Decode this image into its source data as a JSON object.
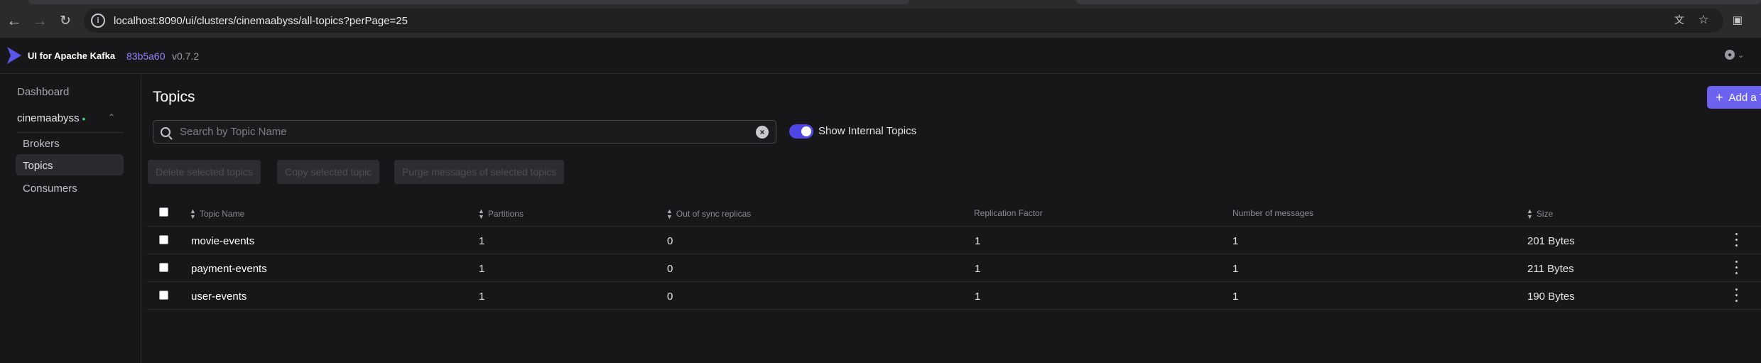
{
  "browser": {
    "url": "localhost:8090/ui/clusters/cinemaabyss/all-topics?perPage=25",
    "back_icon": "arrow-left-icon",
    "forward_icon": "arrow-right-icon",
    "reload_icon": "reload-icon",
    "info_icon": "info-icon",
    "translate_icon": "translate-icon",
    "bookmark_icon": "star-icon",
    "extensions_icon": "extensions-icon"
  },
  "header": {
    "brand": "UI for Apache Kafka",
    "version_hash": "83b5a60",
    "version": "v0.7.2",
    "logo_color": "#5b54e8"
  },
  "sidebar": {
    "dashboard": "Dashboard",
    "cluster": "cinemaabyss",
    "cluster_status_color": "#3fcf8e",
    "items": [
      {
        "label": "Brokers",
        "active": false
      },
      {
        "label": "Topics",
        "active": true
      },
      {
        "label": "Consumers",
        "active": false
      }
    ]
  },
  "main": {
    "title": "Topics",
    "add_button": "Add a Topic",
    "search": {
      "placeholder": "Search by Topic Name",
      "value": ""
    },
    "show_internal": {
      "label": "Show Internal Topics",
      "checked": true
    },
    "bulk_actions": [
      "Delete selected topics",
      "Copy selected topic",
      "Purge messages of selected topics"
    ],
    "columns": [
      {
        "label": "Topic Name",
        "sortable": true
      },
      {
        "label": "Partitions",
        "sortable": true
      },
      {
        "label": "Out of sync replicas",
        "sortable": true
      },
      {
        "label": "Replication Factor",
        "sortable": false
      },
      {
        "label": "Number of messages",
        "sortable": false
      },
      {
        "label": "Size",
        "sortable": true
      }
    ],
    "rows": [
      {
        "name": "movie-events",
        "partitions": "1",
        "out_of_sync": "0",
        "replication": "1",
        "messages": "1",
        "size": "201 Bytes"
      },
      {
        "name": "payment-events",
        "partitions": "1",
        "out_of_sync": "0",
        "replication": "1",
        "messages": "1",
        "size": "211 Bytes"
      },
      {
        "name": "user-events",
        "partitions": "1",
        "out_of_sync": "0",
        "replication": "1",
        "messages": "1",
        "size": "190 Bytes"
      }
    ]
  }
}
